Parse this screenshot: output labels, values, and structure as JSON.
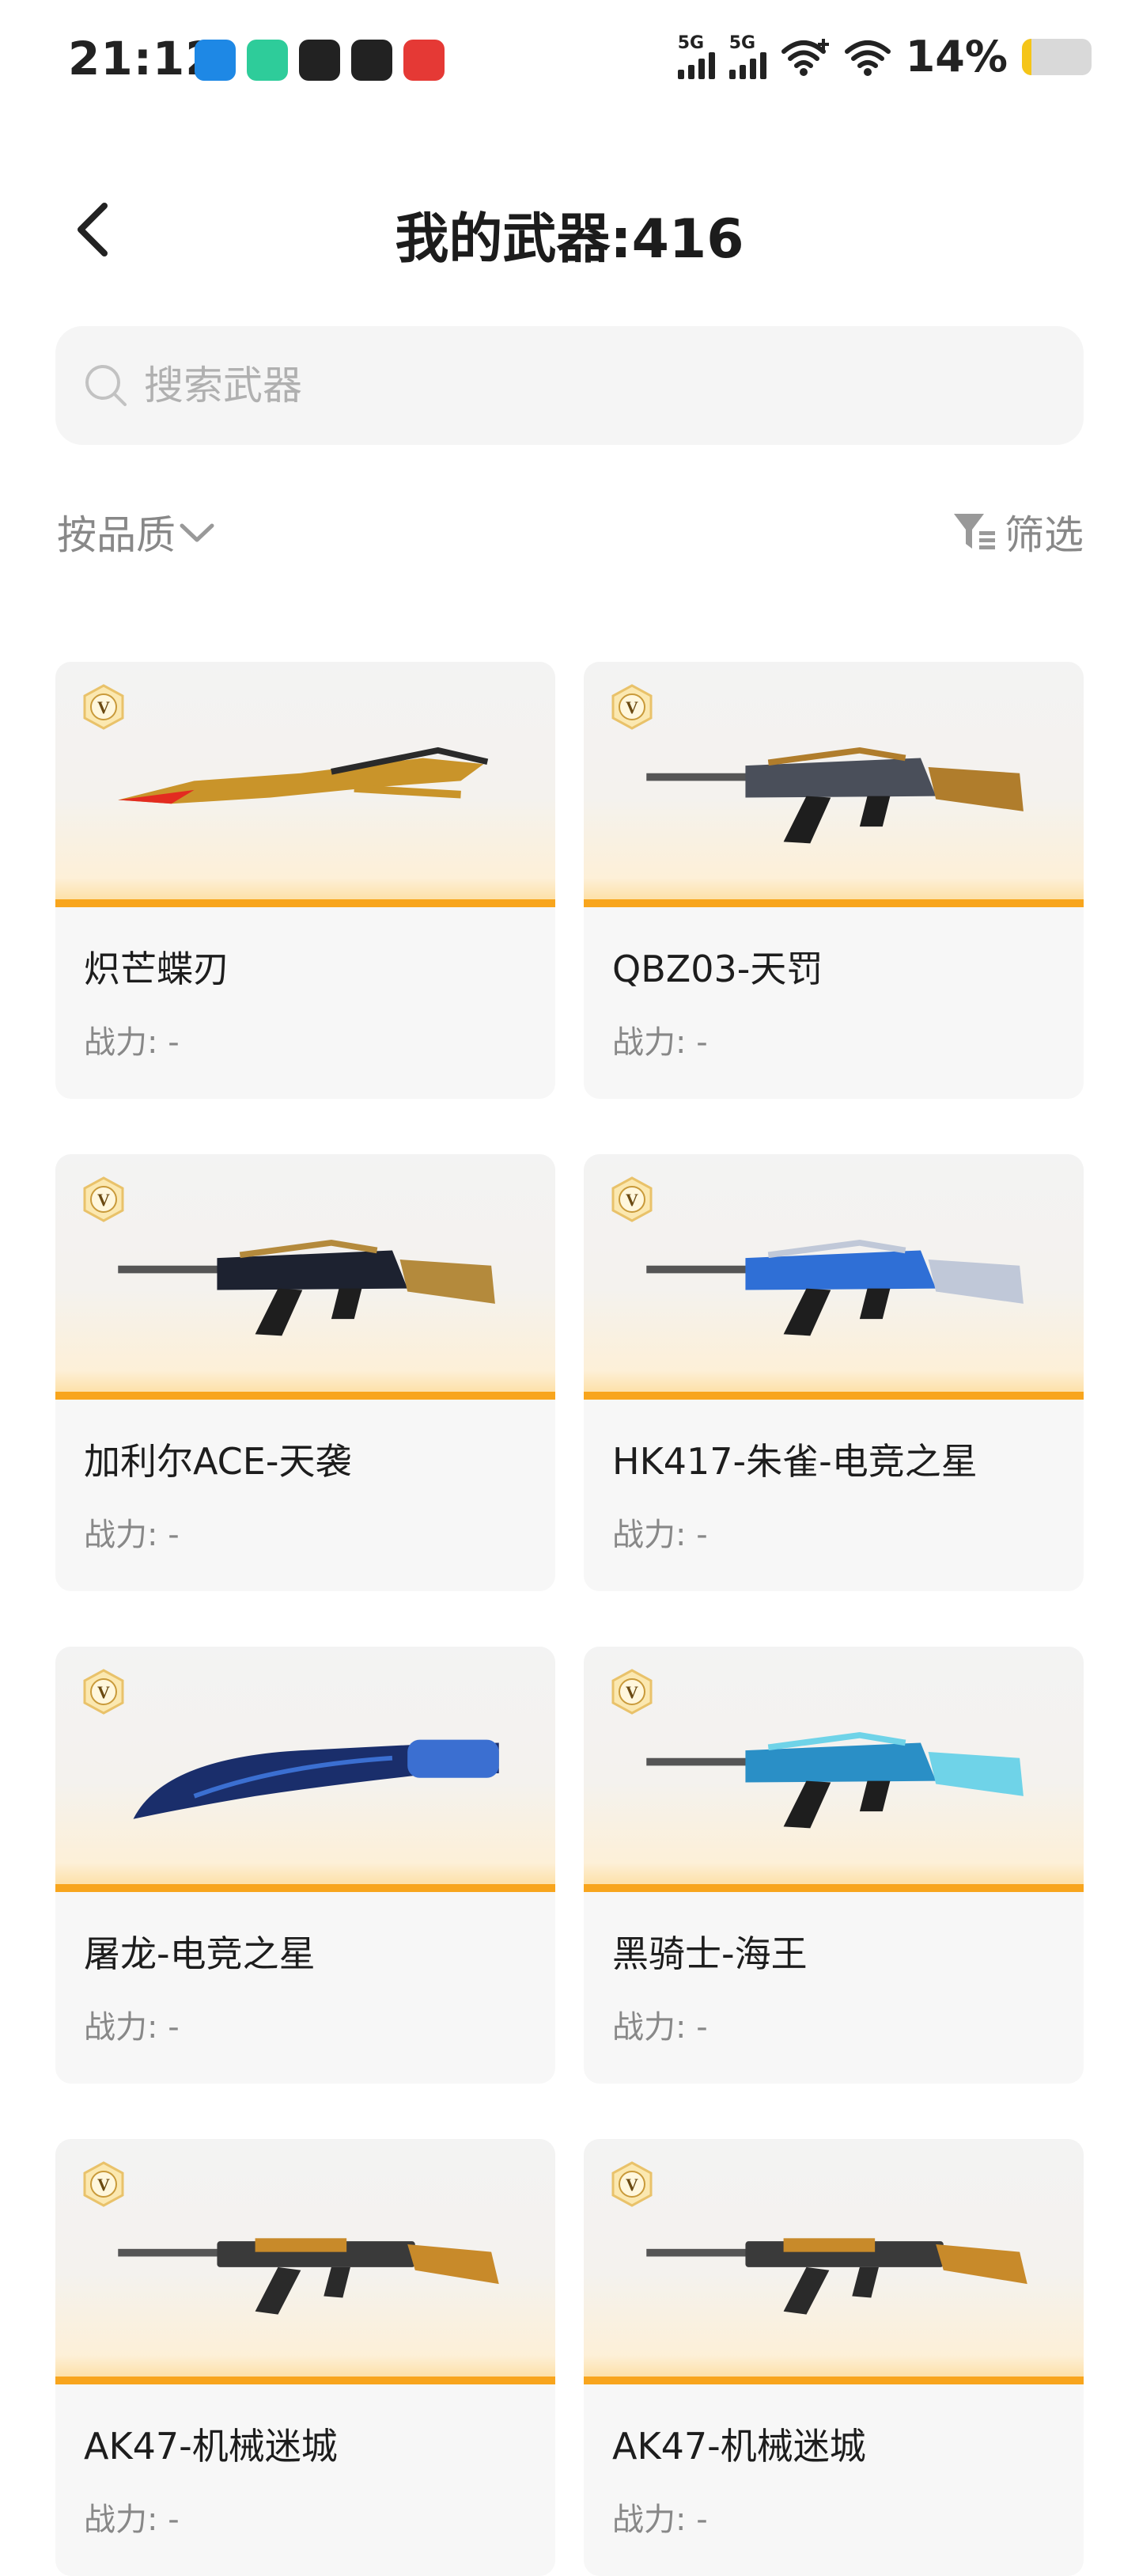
{
  "status_bar": {
    "time": "21:12",
    "signal_label": "5G",
    "battery_percent": "14%",
    "battery_level": 0.14,
    "apps": [
      {
        "icon": "scissors-app-icon",
        "color": "#1e88e5"
      },
      {
        "icon": "camera-app-icon",
        "color": "#2ecc9a"
      },
      {
        "icon": "alipay-app-icon",
        "color": "#222222"
      },
      {
        "icon": "bird-app-icon",
        "color": "#222222"
      },
      {
        "icon": "video-app-icon",
        "color": "#e53935"
      }
    ]
  },
  "header": {
    "title": "我的武器:416"
  },
  "search": {
    "placeholder": "搜索武器"
  },
  "sort": {
    "label": "按品质"
  },
  "filter": {
    "label": "筛选"
  },
  "power_label": "战力: -",
  "weapons": [
    {
      "name": "炽芒蝶刃",
      "power": "战力: -",
      "badge": "V",
      "kind": "blade",
      "colors": [
        "#c9942a",
        "#e32b20"
      ]
    },
    {
      "name": "QBZ03-天罚",
      "power": "战力: -",
      "badge": "V",
      "kind": "rifle",
      "colors": [
        "#4a4f5a",
        "#b07d2c"
      ]
    },
    {
      "name": "加利尔ACE-天袭",
      "power": "战力: -",
      "badge": "V",
      "kind": "rifle",
      "colors": [
        "#1d2230",
        "#b48a3c"
      ]
    },
    {
      "name": "HK417-朱雀-电竞之星",
      "power": "战力: -",
      "badge": "V",
      "kind": "rifle",
      "colors": [
        "#2f6fd6",
        "#c0c8d8"
      ]
    },
    {
      "name": "屠龙-电竞之星",
      "power": "战力: -",
      "badge": "V",
      "kind": "knife",
      "colors": [
        "#1a2e6b",
        "#3b6fd1"
      ]
    },
    {
      "name": "黑骑士-海王",
      "power": "战力: -",
      "badge": "V",
      "kind": "rifle",
      "colors": [
        "#2a8fc6",
        "#6fd3e8"
      ]
    },
    {
      "name": "AK47-机械迷城",
      "power": "战力: -",
      "badge": "V",
      "kind": "ak",
      "colors": [
        "#c88a2a",
        "#3a3a3a"
      ]
    },
    {
      "name": "AK47-机械迷城",
      "power": "战力: -",
      "badge": "V",
      "kind": "ak",
      "colors": [
        "#c88a2a",
        "#3a3a3a"
      ]
    }
  ],
  "accent_color": "#f8a51d"
}
